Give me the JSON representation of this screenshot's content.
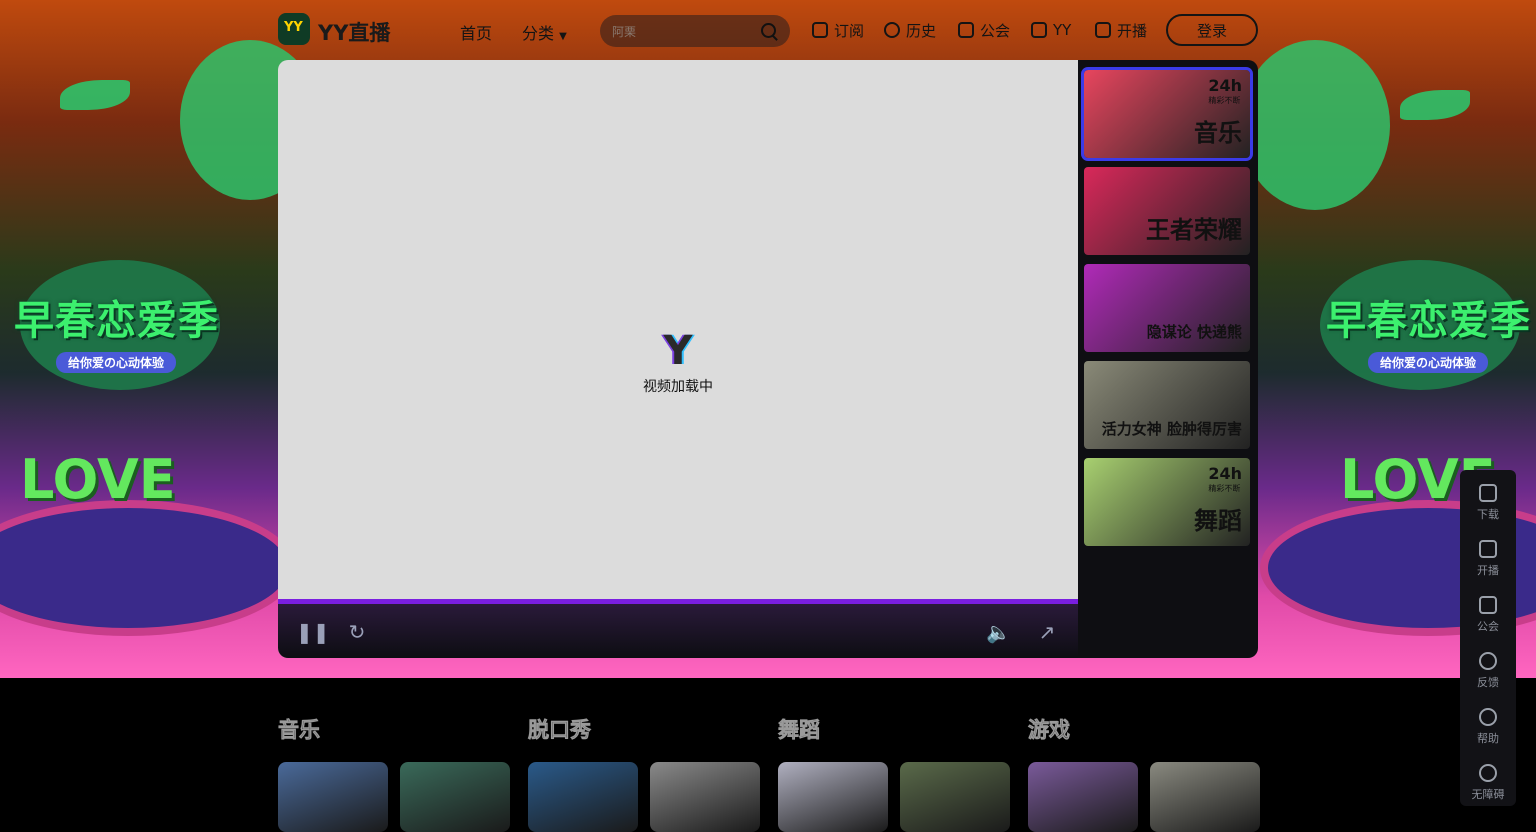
{
  "nav": {
    "logo_mark": "YY",
    "logo_text": "YY直播",
    "home": "首页",
    "category": "分类",
    "search_placeholder": "阿栗",
    "subscribe": "订阅",
    "history": "历史",
    "guild": "公会",
    "yy": "YY",
    "broadcast": "开播",
    "login": "登录"
  },
  "hero": {
    "badge_title": "早春恋爱季",
    "badge_sub": "给你爱の心动体验",
    "love": "LOVE"
  },
  "player": {
    "loading_logo": "Y",
    "loading_text": "视频加载中",
    "progress": 1.0
  },
  "channels": [
    {
      "label": "音乐",
      "tag": "24h",
      "tag_sub": "精彩不断",
      "color": "#e8455e",
      "active": true
    },
    {
      "label": "王者荣耀",
      "tag": "",
      "tag_sub": "",
      "color": "#d9285a",
      "active": false
    },
    {
      "label": "隐谋论 快递熊",
      "tag": "",
      "tag_sub": "",
      "color": "#b02ab8",
      "active": false
    },
    {
      "label": "活力女神 脸肿得厉害",
      "tag": "",
      "tag_sub": "",
      "color": "#8a8a78",
      "active": false
    },
    {
      "label": "舞蹈",
      "tag": "24h",
      "tag_sub": "精彩不断",
      "color": "#a8d070",
      "active": false
    }
  ],
  "side_toolbar": [
    {
      "label": "下载",
      "icon": "download-icon"
    },
    {
      "label": "开播",
      "icon": "camera-icon"
    },
    {
      "label": "公会",
      "icon": "shield-icon"
    },
    {
      "label": "反馈",
      "icon": "feedback-icon"
    },
    {
      "label": "帮助",
      "icon": "headset-icon"
    },
    {
      "label": "无障碍",
      "icon": "accessibility-icon"
    }
  ],
  "categories": [
    "音乐",
    "脱口秀",
    "舞蹈",
    "游戏"
  ],
  "thumb_colors": [
    "#4a6a9a",
    "#3a6a5a",
    "#2a5a8a",
    "#8a8a8a",
    "#b0b0c0",
    "#5a6a4a",
    "#7a5a9a",
    "#8a8a80"
  ]
}
